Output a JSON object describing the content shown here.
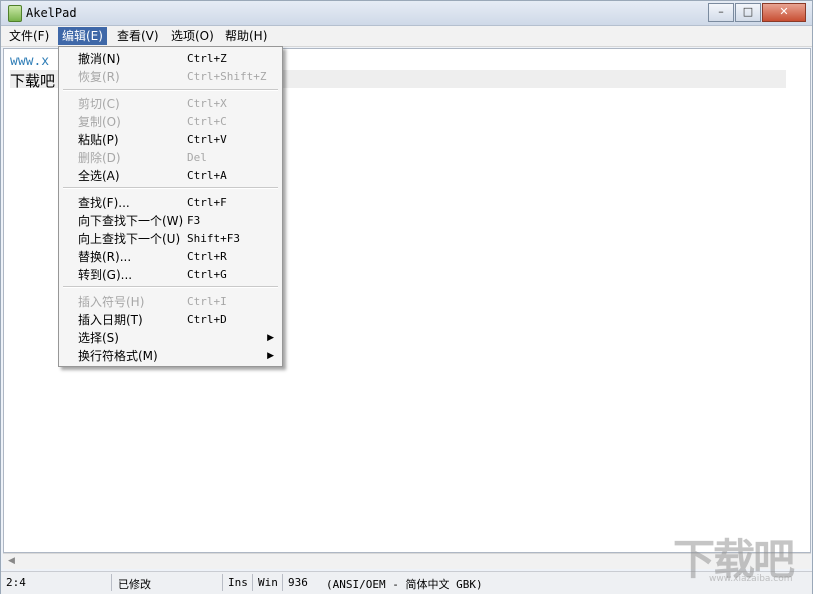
{
  "window": {
    "title": "AkelPad",
    "minimize": "–",
    "maximize": "□",
    "close": "✕"
  },
  "menubar": {
    "items": [
      {
        "label": "文件(F)"
      },
      {
        "label": "编辑(E)"
      },
      {
        "label": "查看(V)"
      },
      {
        "label": "选项(O)"
      },
      {
        "label": "帮助(H)"
      }
    ]
  },
  "editor": {
    "line1": "www.x",
    "line2": "下载吧"
  },
  "edit_menu": {
    "items": [
      {
        "label": "撤消(N)",
        "shortcut": "Ctrl+Z",
        "enabled": true
      },
      {
        "label": "恢复(R)",
        "shortcut": "Ctrl+Shift+Z",
        "enabled": false
      },
      {
        "label": "剪切(C)",
        "shortcut": "Ctrl+X",
        "enabled": false
      },
      {
        "label": "复制(O)",
        "shortcut": "Ctrl+C",
        "enabled": false
      },
      {
        "label": "粘贴(P)",
        "shortcut": "Ctrl+V",
        "enabled": true
      },
      {
        "label": "删除(D)",
        "shortcut": "Del",
        "enabled": false
      },
      {
        "label": "全选(A)",
        "shortcut": "Ctrl+A",
        "enabled": true
      },
      {
        "label": "查找(F)...",
        "shortcut": "Ctrl+F",
        "enabled": true
      },
      {
        "label": "向下查找下一个(W)",
        "shortcut": "F3",
        "enabled": true
      },
      {
        "label": "向上查找下一个(U)",
        "shortcut": "Shift+F3",
        "enabled": true
      },
      {
        "label": "替换(R)...",
        "shortcut": "Ctrl+R",
        "enabled": true
      },
      {
        "label": "转到(G)...",
        "shortcut": "Ctrl+G",
        "enabled": true
      },
      {
        "label": "插入符号(H)",
        "shortcut": "Ctrl+I",
        "enabled": false
      },
      {
        "label": "插入日期(T)",
        "shortcut": "Ctrl+D",
        "enabled": true
      },
      {
        "label": "选择(S)",
        "shortcut": "",
        "enabled": true
      },
      {
        "label": "换行符格式(M)",
        "shortcut": "",
        "enabled": true
      }
    ]
  },
  "statusbar": {
    "position": "2:4",
    "modified": "已修改",
    "insert_mode": "Ins",
    "newline": "Win",
    "codepage": "936",
    "encoding": "(ANSI/OEM - 简体中文 GBK)"
  },
  "watermark": {
    "text": "下载吧",
    "sub": "www.xiazaiba.com"
  }
}
